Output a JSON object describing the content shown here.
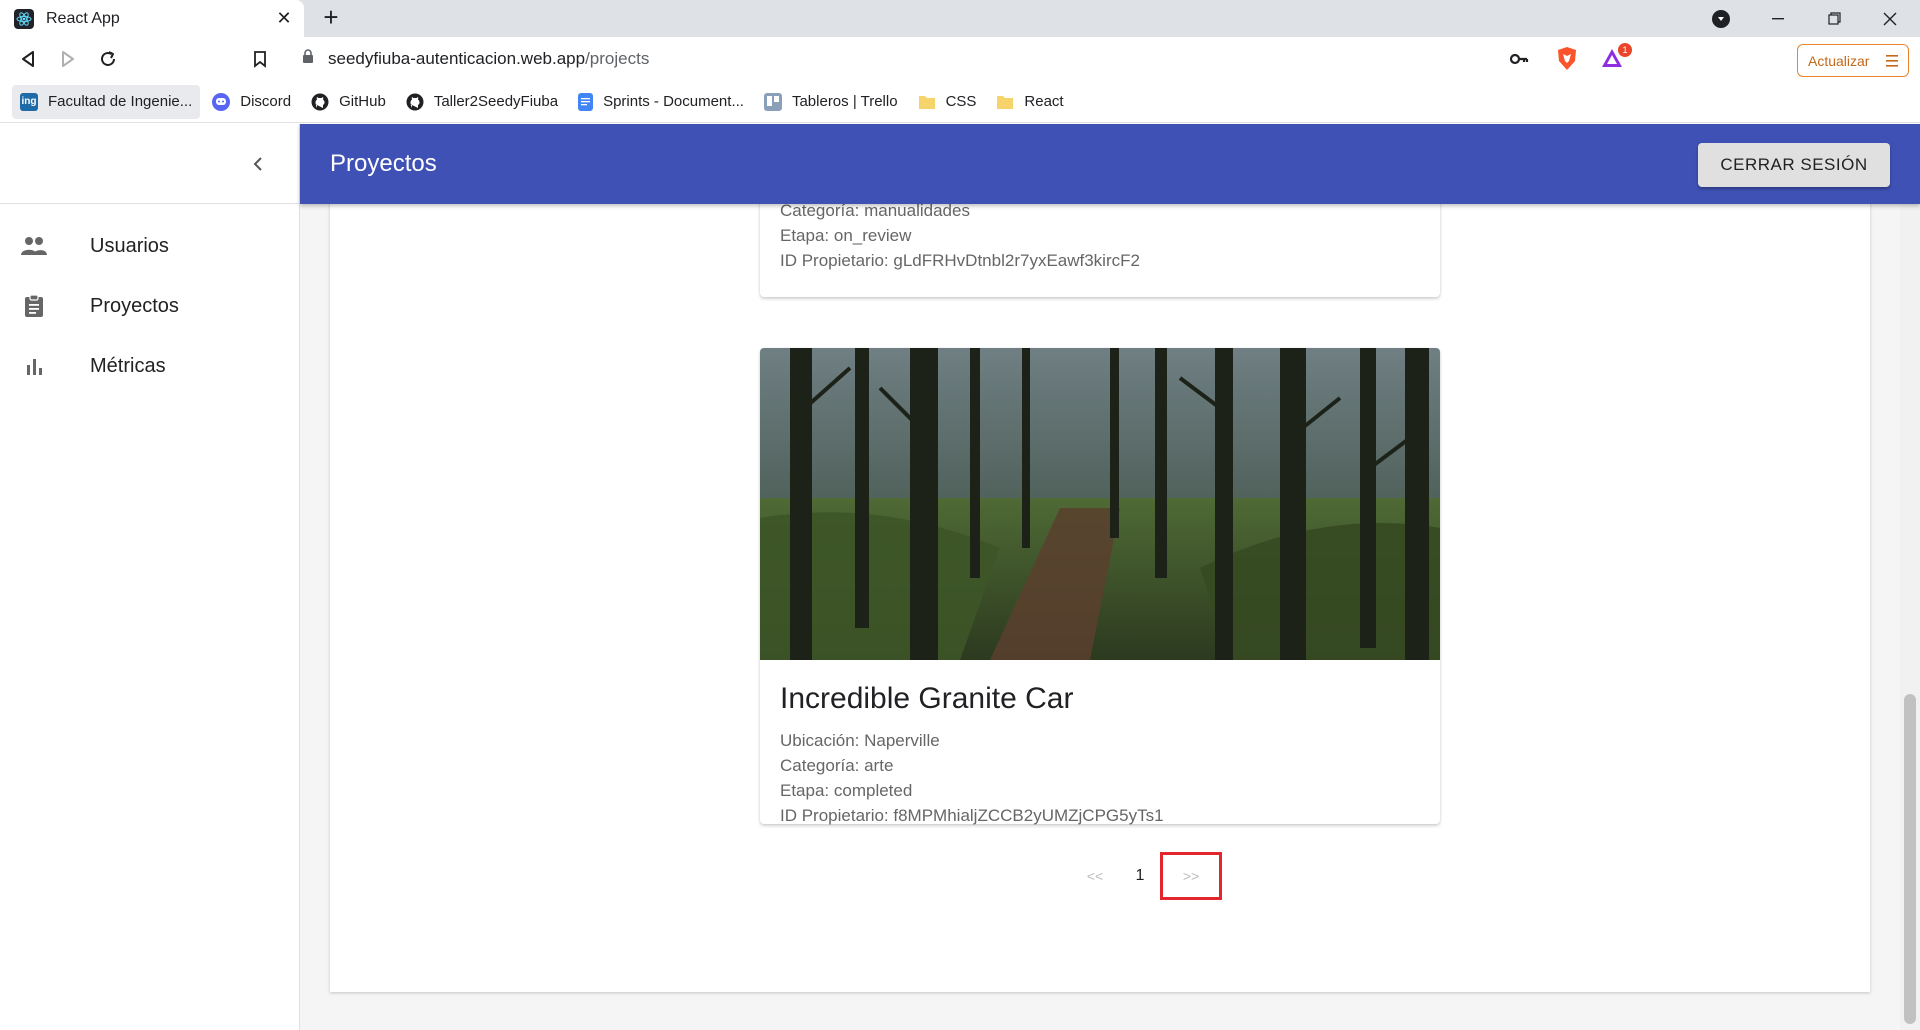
{
  "browser": {
    "tab_title": "React App",
    "url_host": "seedyfiuba-autenticacion.web.app",
    "url_path": "/projects",
    "update_label": "Actualizar",
    "rewards_badge": "1",
    "bookmarks": [
      {
        "label": "Facultad de Ingenie...",
        "icon": "fiuba-icon"
      },
      {
        "label": "Discord",
        "icon": "discord-icon"
      },
      {
        "label": "GitHub",
        "icon": "github-icon"
      },
      {
        "label": "Taller2SeedyFiuba",
        "icon": "github-icon"
      },
      {
        "label": "Sprints - Document...",
        "icon": "docs-icon"
      },
      {
        "label": "Tableros | Trello",
        "icon": "trello-icon"
      },
      {
        "label": "CSS",
        "icon": "folder-icon"
      },
      {
        "label": "React",
        "icon": "folder-icon"
      }
    ]
  },
  "app": {
    "title": "Proyectos",
    "logout_label": "CERRAR SESIÓN",
    "nav": [
      {
        "label": "Usuarios",
        "icon": "people-icon"
      },
      {
        "label": "Proyectos",
        "icon": "clipboard-icon"
      },
      {
        "label": "Métricas",
        "icon": "bar-chart-icon"
      }
    ]
  },
  "projects": {
    "previous_card": {
      "lines": [
        "Categoría: manualidades",
        "Etapa: on_review",
        "ID Propietario: gLdFRHvDtnbl2r7yxEawf3kircF2"
      ]
    },
    "current_card": {
      "title": "Incredible Granite Car",
      "lines": [
        "Ubicación: Naperville",
        "Categoría: arte",
        "Etapa: completed",
        "ID Propietario: f8MPMhialjZCCB2yUMZjCPG5yTs1"
      ]
    },
    "pagination": {
      "prev": "<<",
      "page": "1",
      "next": ">>"
    }
  }
}
